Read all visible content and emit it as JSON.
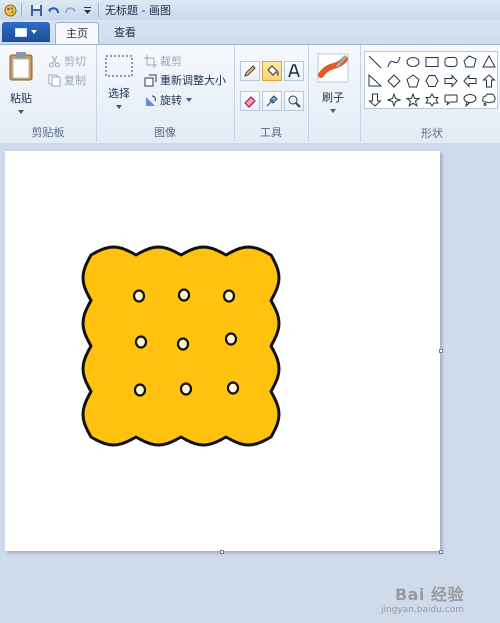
{
  "window": {
    "title": "无标题 - 画图"
  },
  "tabs": [
    {
      "label": "主页",
      "active": true
    },
    {
      "label": "查看",
      "active": false
    }
  ],
  "clipboard": {
    "paste_label": "粘贴",
    "cut_label": "剪切",
    "copy_label": "复制",
    "group_label": "剪贴板"
  },
  "image": {
    "select_label": "选择",
    "crop_label": "裁剪",
    "resize_label": "重新调整大小",
    "rotate_label": "旋转",
    "group_label": "图像"
  },
  "tools": {
    "group_label": "工具",
    "active_tool": "fill"
  },
  "brushes": {
    "label": "刷子"
  },
  "shapes": {
    "group_label": "形状",
    "items": [
      "line",
      "curve",
      "oval",
      "rectangle",
      "rounded-rectangle",
      "polygon",
      "triangle",
      "right-triangle",
      "diamond",
      "pentagon",
      "hexagon",
      "right-arrow",
      "left-arrow",
      "up-arrow",
      "down-arrow",
      "four-point-star",
      "five-point-star",
      "six-point-star",
      "rounded-callout",
      "oval-callout",
      "cloud-callout"
    ]
  },
  "drawing": {
    "fill_color": "#FFC20E",
    "outline_color": "#111111",
    "hole_color": "#FFF6D0",
    "hole_count": 9
  },
  "watermark": {
    "main": "Bai 经验",
    "sub": "jingyan.baidu.com"
  }
}
